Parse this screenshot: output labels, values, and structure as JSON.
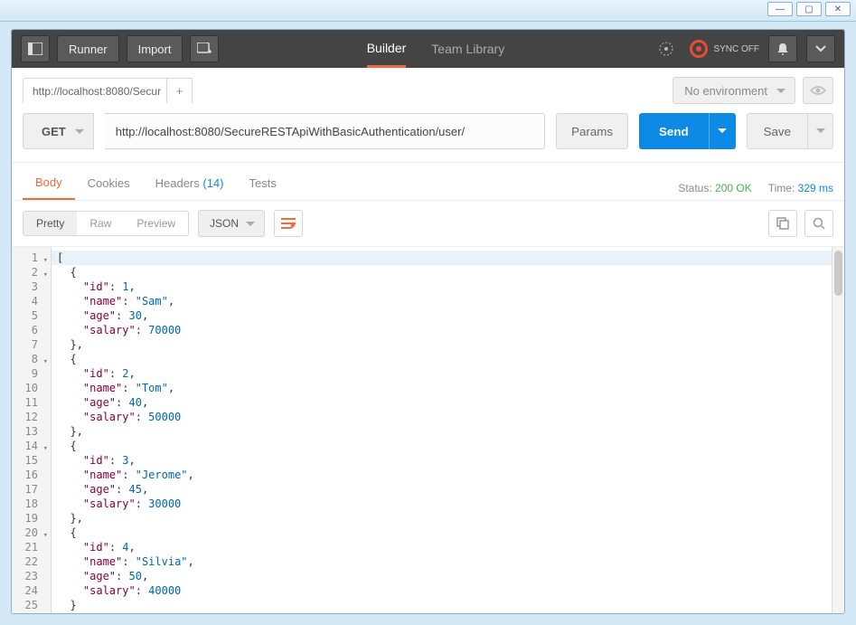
{
  "window": {
    "min": "—",
    "max": "▢",
    "close": "✕"
  },
  "topbar": {
    "runner": "Runner",
    "import": "Import",
    "tabs": {
      "builder": "Builder",
      "team": "Team Library"
    },
    "sync": "SYNC OFF"
  },
  "sub": {
    "tab_title": "http://localhost:8080/Secur",
    "add": "+",
    "env": "No environment"
  },
  "request": {
    "method": "GET",
    "url": "http://localhost:8080/SecureRESTApiWithBasicAuthentication/user/",
    "params": "Params",
    "send": "Send",
    "save": "Save"
  },
  "response_tabs": {
    "body": "Body",
    "cookies": "Cookies",
    "headers": "Headers",
    "headers_count": "(14)",
    "tests": "Tests"
  },
  "meta": {
    "status_label": "Status:",
    "status_value": "200 OK",
    "time_label": "Time:",
    "time_value": "329 ms"
  },
  "view": {
    "pretty": "Pretty",
    "raw": "Raw",
    "preview": "Preview",
    "format": "JSON"
  },
  "json_body": [
    {
      "id": 1,
      "name": "Sam",
      "age": 30,
      "salary": 70000
    },
    {
      "id": 2,
      "name": "Tom",
      "age": 40,
      "salary": 50000
    },
    {
      "id": 3,
      "name": "Jerome",
      "age": 45,
      "salary": 30000
    },
    {
      "id": 4,
      "name": "Silvia",
      "age": 50,
      "salary": 40000
    }
  ]
}
